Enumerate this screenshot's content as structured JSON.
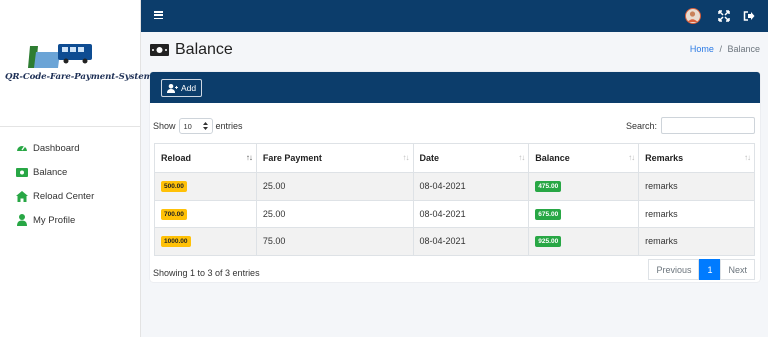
{
  "sidebar": {
    "logo_text": "QR-Code-Fare-Payment-System",
    "items": [
      {
        "label": "Dashboard",
        "icon": "tachometer-icon"
      },
      {
        "label": "Balance",
        "icon": "money-bill-icon"
      },
      {
        "label": "Reload Center",
        "icon": "home-icon"
      },
      {
        "label": "My Profile",
        "icon": "user-icon"
      }
    ]
  },
  "header": {
    "title": "Balance",
    "breadcrumb": {
      "home": "Home",
      "separator": "/",
      "current": "Balance"
    }
  },
  "card": {
    "add_label": "Add",
    "show_label": "Show",
    "entries_value": "10",
    "entries_label": "entries",
    "search_label": "Search:"
  },
  "table": {
    "columns": [
      "Reload",
      "Fare Payment",
      "Date",
      "Balance",
      "Remarks"
    ],
    "rows": [
      {
        "reload": "500.00",
        "fare": "25.00",
        "date": "08-04-2021",
        "balance": "475.00",
        "remarks": "remarks"
      },
      {
        "reload": "700.00",
        "fare": "25.00",
        "date": "08-04-2021",
        "balance": "675.00",
        "remarks": "remarks"
      },
      {
        "reload": "1000.00",
        "fare": "75.00",
        "date": "08-04-2021",
        "balance": "925.00",
        "remarks": "remarks"
      }
    ]
  },
  "footer": {
    "info": "Showing 1 to 3 of 3 entries",
    "prev": "Previous",
    "page": "1",
    "next": "Next"
  },
  "colors": {
    "topbar": "#0c3d6b",
    "accent": "#007bff",
    "warning": "#ffc107",
    "success": "#28a745",
    "nav_icon": "#28a745"
  }
}
